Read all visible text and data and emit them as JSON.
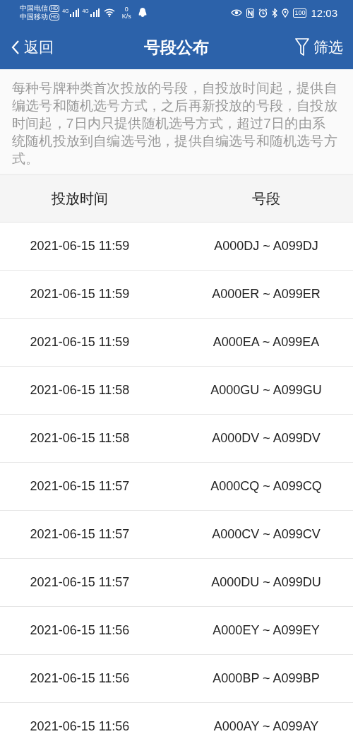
{
  "status_bar": {
    "carriers": [
      {
        "name": "中国电信",
        "badge": "HD"
      },
      {
        "name": "中国移动",
        "badge": "HD"
      }
    ],
    "signals": [
      "4G",
      "4G"
    ],
    "speed_value": "0",
    "speed_unit": "K/s",
    "battery": "100",
    "time": "12:03"
  },
  "header": {
    "back": "返回",
    "title": "号段公布",
    "filter": "筛选"
  },
  "notice": "每种号牌种类首次投放的号段，自投放时间起，提供自编选号和随机选号方式，之后再新投放的号段，自投放时间起，7日内只提供随机选号方式，超过7日的由系统随机投放到自编选号池，提供自编选号和随机选号方式。",
  "table": {
    "columns": [
      "投放时间",
      "号段"
    ],
    "rows": [
      {
        "time": "2021-06-15 11:59",
        "range": "A000DJ ~ A099DJ"
      },
      {
        "time": "2021-06-15 11:59",
        "range": "A000ER ~ A099ER"
      },
      {
        "time": "2021-06-15 11:59",
        "range": "A000EA ~ A099EA"
      },
      {
        "time": "2021-06-15 11:58",
        "range": "A000GU ~ A099GU"
      },
      {
        "time": "2021-06-15 11:58",
        "range": "A000DV ~ A099DV"
      },
      {
        "time": "2021-06-15 11:57",
        "range": "A000CQ ~ A099CQ"
      },
      {
        "time": "2021-06-15 11:57",
        "range": "A000CV ~ A099CV"
      },
      {
        "time": "2021-06-15 11:57",
        "range": "A000DU ~ A099DU"
      },
      {
        "time": "2021-06-15 11:56",
        "range": "A000EY ~ A099EY"
      },
      {
        "time": "2021-06-15 11:56",
        "range": "A000BP ~ A099BP"
      },
      {
        "time": "2021-06-15 11:56",
        "range": "A000AY ~ A099AY"
      }
    ]
  }
}
